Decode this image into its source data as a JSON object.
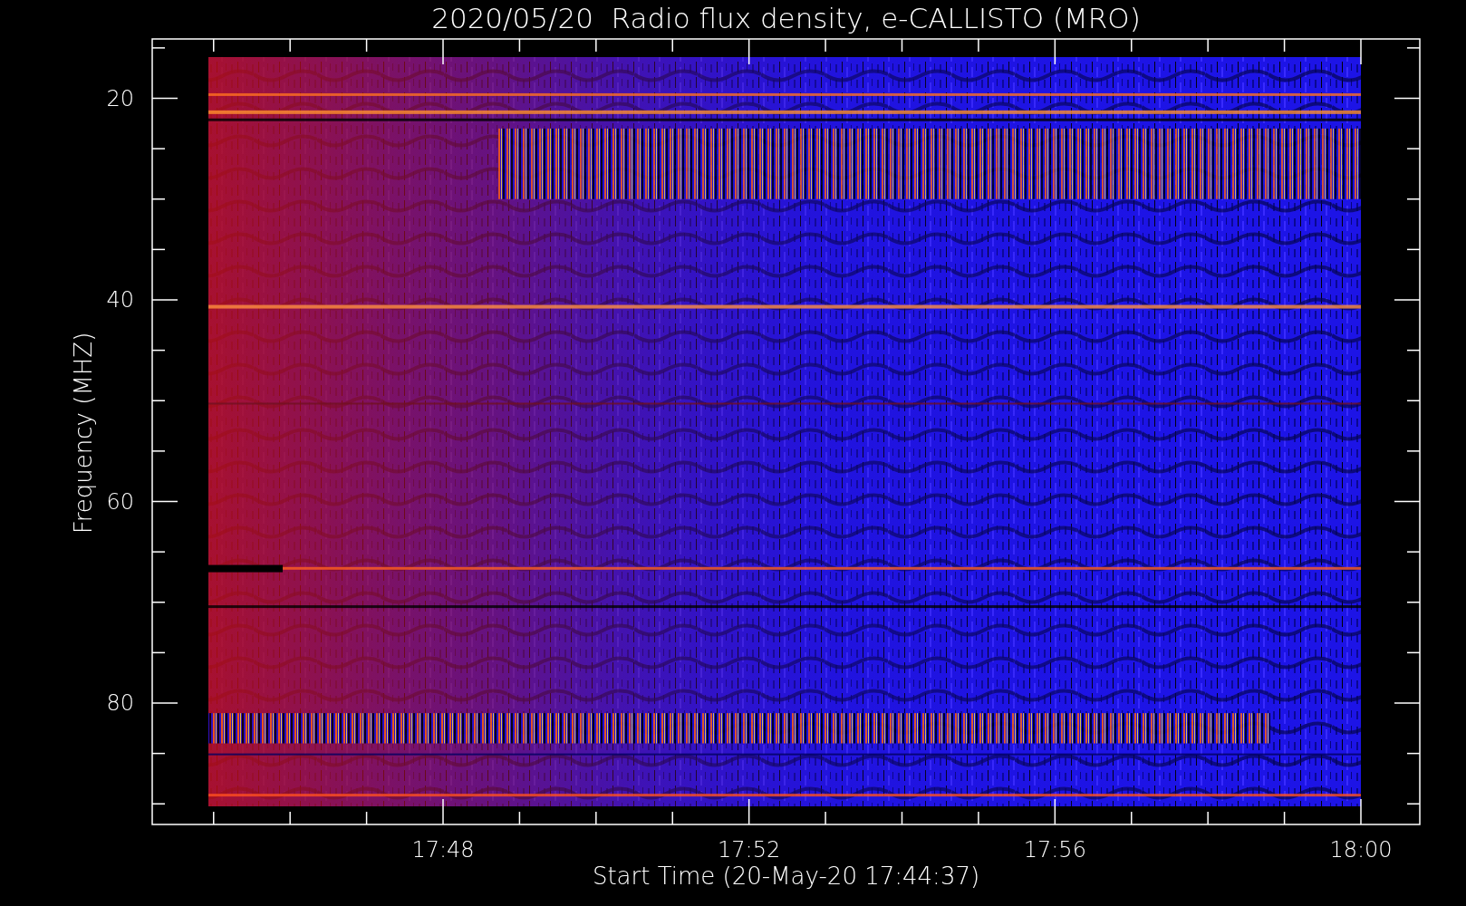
{
  "title": "2020/05/20  Radio flux density, e-CALLISTO (MRO)",
  "plot": {
    "ylabel": "Frequency (MHZ)",
    "xlabel": "Start Time (20-May-20 17:44:37)",
    "yticks": [
      "20",
      "40",
      "60",
      "80"
    ],
    "xticks": [
      "17:48",
      "17:52",
      "17:56",
      "18:00"
    ]
  }
}
